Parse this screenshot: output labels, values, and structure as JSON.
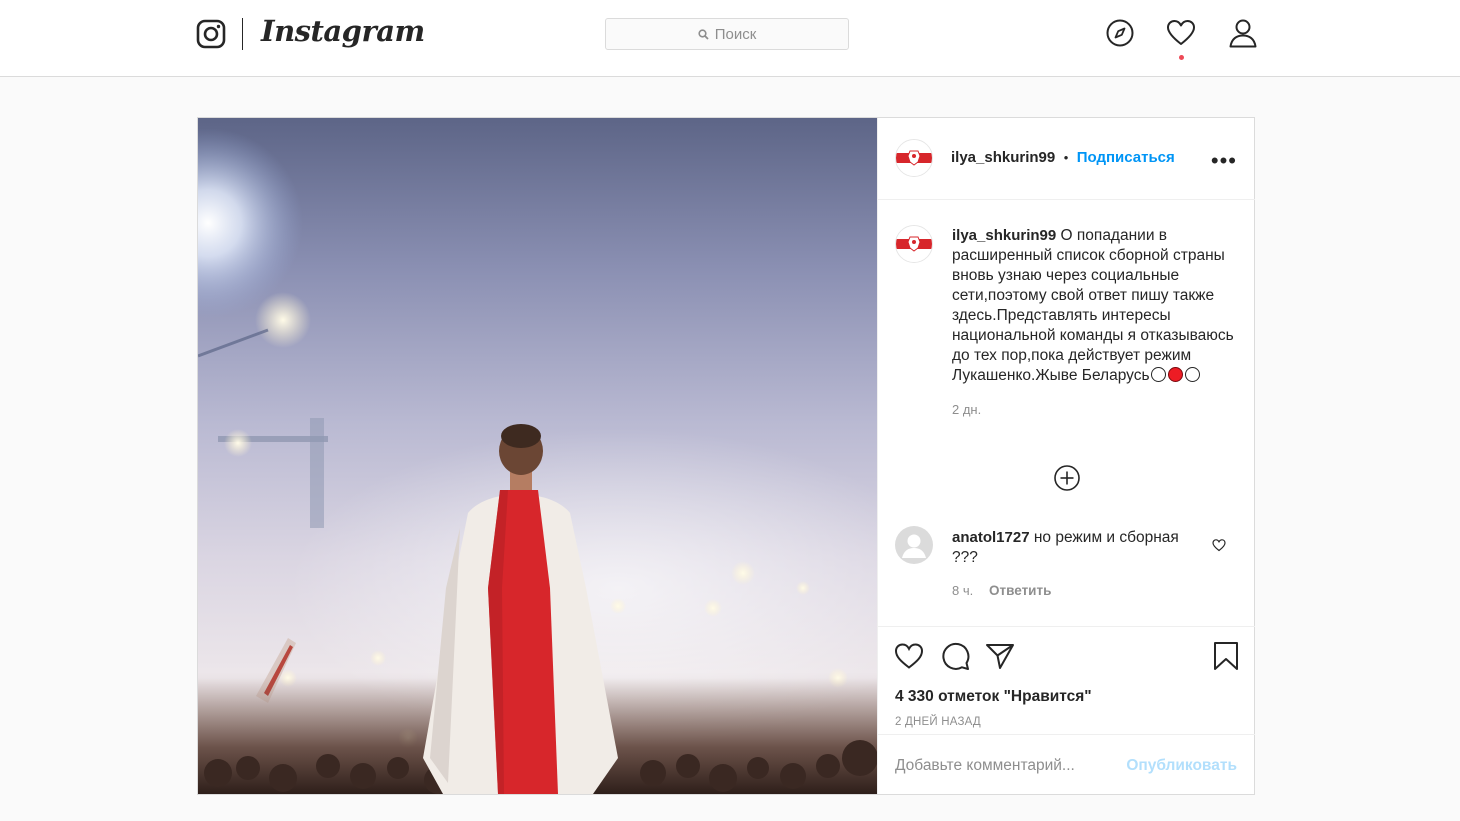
{
  "header": {
    "brand": "Instagram",
    "search_placeholder": "Поиск"
  },
  "post": {
    "author": "ilya_shkurin99",
    "follow_label": "Подписаться",
    "separator": "•",
    "more_label": "•••",
    "caption": "О попадании в расширенный список сборной страны вновь узнаю через социальные сети,поэтому свой ответ пишу также здесь.Представлять интересы национальной команды я отказываюсь до тех пор,пока действует режим Лукашенко.Жыве Беларусь",
    "caption_time": "2 дн.",
    "comment": {
      "author": "anatol1727",
      "text": "но режим и сборная ???",
      "time": "8 ч.",
      "reply_label": "Ответить"
    },
    "likes_text": "4 330 отметок \"Нравится\"",
    "posted_ago": "2 ДНЕЙ НАЗАД",
    "add_comment_placeholder": "Добавьте комментарий...",
    "publish_label": "Опубликовать"
  },
  "icons": {
    "logo": "instagram-logo-icon",
    "search": "search-icon",
    "explore": "compass-icon",
    "activity": "heart-icon",
    "profile": "person-icon",
    "like": "heart-icon",
    "comment": "speech-bubble-icon",
    "share": "paper-plane-icon",
    "save": "bookmark-icon",
    "load_more": "plus-circle-icon"
  },
  "colors": {
    "link_blue": "#0095f6",
    "publish_disabled": "#b2dffc",
    "notification_red": "#ed4956",
    "flag_red": "#d7262b",
    "text_main": "#262626",
    "text_muted": "#8e8e8e"
  }
}
